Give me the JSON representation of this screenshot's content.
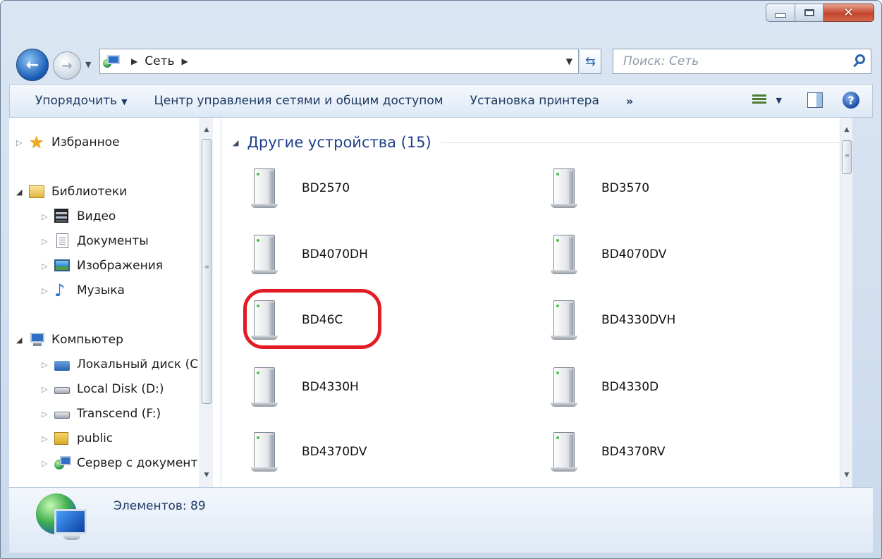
{
  "address_bar": {
    "crumbs": [
      "Сеть"
    ],
    "search_placeholder": "Поиск: Сеть"
  },
  "toolbar": {
    "organize": "Упорядочить",
    "network_center": "Центр управления сетями и общим доступом",
    "add_printer": "Установка принтера",
    "more": "»"
  },
  "nav_pane": {
    "favorites": "Избранное",
    "libraries": "Библиотеки",
    "video": "Видео",
    "documents": "Документы",
    "images": "Изображения",
    "music": "Музыка",
    "computer": "Компьютер",
    "local_c": "Локальный диск (C",
    "local_d": "Local Disk (D:)",
    "transcend": "Transcend (F:)",
    "public": "public",
    "server": "Сервер с документ"
  },
  "content": {
    "group_title": "Другие устройства (15)",
    "devices": [
      "BD2570",
      "BD3570",
      "BD4070DH",
      "BD4070DV",
      "BD46C",
      "BD4330DVH",
      "BD4330H",
      "BD4330D",
      "BD4370DV",
      "BD4370RV"
    ],
    "highlighted_device": "BD46C"
  },
  "status": {
    "items_text": "Элементов: 89"
  },
  "colors": {
    "highlight": "#e31c24",
    "link_text": "#1e3a64",
    "group_header": "#1e3f8a"
  }
}
